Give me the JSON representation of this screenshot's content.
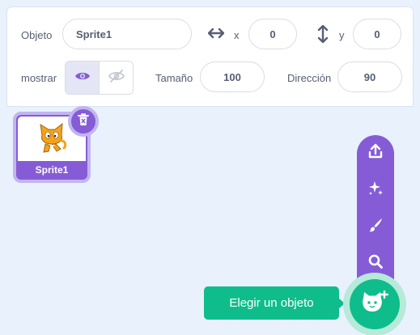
{
  "sprite_info": {
    "object_label": "Objeto",
    "object_name": "Sprite1",
    "x_label": "x",
    "x_value": "0",
    "y_label": "y",
    "y_value": "0",
    "show_label": "mostrar",
    "size_label": "Tamaño",
    "size_value": "100",
    "direction_label": "Dirección",
    "direction_value": "90"
  },
  "sprites": [
    {
      "name": "Sprite1",
      "selected": true
    }
  ],
  "choose_menu": {
    "tooltip": "Elegir un objeto",
    "items": [
      "upload-icon",
      "surprise-icon",
      "paint-icon",
      "search-icon"
    ],
    "main_icon": "cat-plus-icon"
  },
  "colors": {
    "accent_purple": "#855cd6",
    "accent_green": "#0fbd8c",
    "pane_bg": "#e9f1fc"
  }
}
